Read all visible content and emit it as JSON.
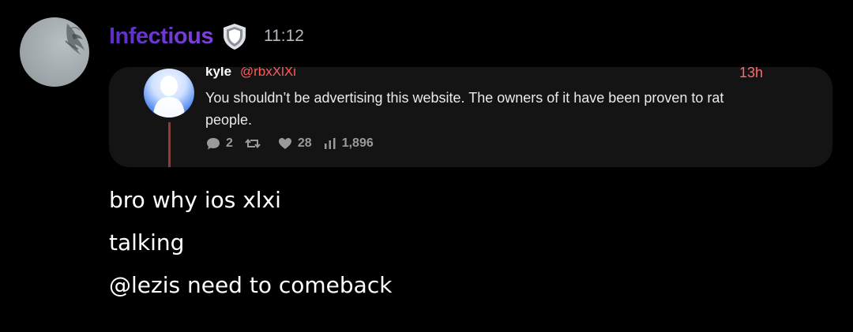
{
  "author": {
    "name": "Infectious",
    "badge_icon": "shield-icon",
    "timestamp": "11:12",
    "name_color": "#6a3ad1"
  },
  "embed": {
    "name": "kyle",
    "handle": "@rbxXlXi",
    "time": "13h",
    "text": "You shouldn’t be advertising this website. The owners of it have been proven to rat people.",
    "stats": {
      "replies": "2",
      "retweets": "",
      "likes": "28",
      "views": "1,896"
    },
    "accent_color": "#ff5a5a"
  },
  "messages": [
    "bro why ios xlxi",
    "talking",
    "@lezis need to comeback"
  ]
}
